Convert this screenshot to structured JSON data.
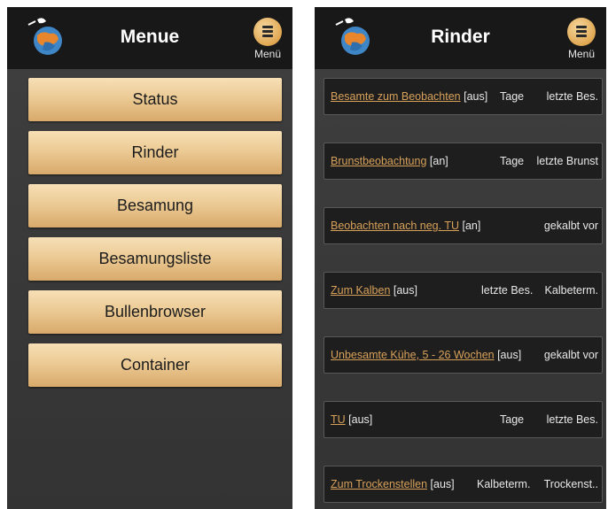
{
  "left_screen": {
    "title": "Menue",
    "menu_label": "Menü",
    "items": [
      "Status",
      "Rinder",
      "Besamung",
      "Besamungsliste",
      "Bullenbrowser",
      "Container"
    ]
  },
  "right_screen": {
    "title": "Rinder",
    "menu_label": "Menü",
    "rows": [
      {
        "link": "Besamte zum Beobachten",
        "state": " [aus]",
        "col2": "Tage",
        "col3": "letzte Bes."
      },
      {
        "link": "Brunstbeobachtung",
        "state": " [an]",
        "col2": "Tage",
        "col3": "letzte Brunst"
      },
      {
        "link": "Beobachten nach neg. TU",
        "state": " [an]",
        "col2": "",
        "col3": "gekalbt vor"
      },
      {
        "link": "Zum Kalben",
        "state": " [aus]",
        "col2": "letzte Bes.",
        "col3": "Kalbeterm."
      },
      {
        "link": "Unbesamte Kühe, 5 - 26 Wochen",
        "state": " [aus]",
        "col2": "",
        "col3": "gekalbt vor"
      },
      {
        "link": "TU",
        "state": " [aus]",
        "col2": "Tage",
        "col3": "letzte Bes."
      },
      {
        "link": "Zum Trockenstellen",
        "state": " [aus]",
        "col2": "Kalbeterm.",
        "col3": "Trockenst.."
      }
    ]
  },
  "colors": {
    "accent": "#e0a752",
    "link": "#d8a15a",
    "appbar": "#181818",
    "background": "#3a3a3a"
  },
  "icons": [
    "app-logo-icon",
    "menu-icon"
  ]
}
